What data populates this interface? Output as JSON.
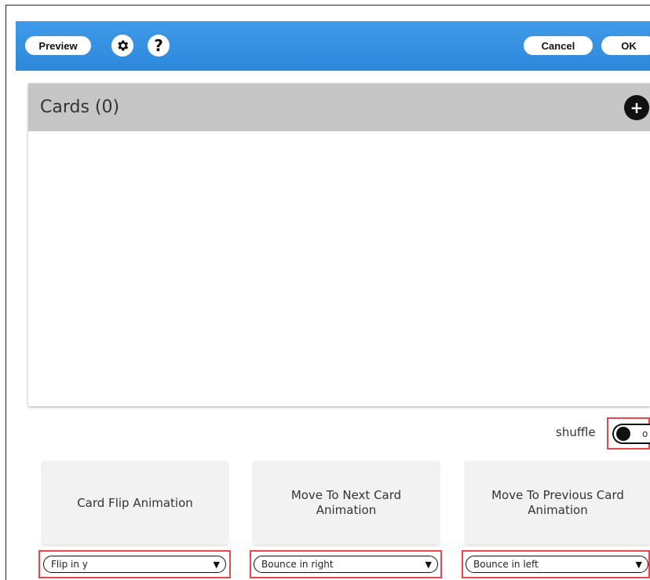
{
  "toolbar": {
    "preview_label": "Preview",
    "settings_icon": "gear-icon",
    "help_icon": "help-icon",
    "help_glyph": "?",
    "cancel_label": "Cancel",
    "ok_label": "OK",
    "bar_color": "#2d88dc"
  },
  "cards": {
    "title": "Cards (0)",
    "add_icon": "plus-icon",
    "add_glyph": "+"
  },
  "shuffle": {
    "label": "shuffle",
    "toggle_text": "o"
  },
  "animations": [
    {
      "label": "Card Flip Animation",
      "selected": "Flip in y"
    },
    {
      "label": "Move To Next Card Animation",
      "selected": "Bounce in right"
    },
    {
      "label": "Move To Previous Card Animation",
      "selected": "Bounce in left"
    }
  ],
  "highlight_color": "#e8474e",
  "dropdown_arrow": "▼"
}
